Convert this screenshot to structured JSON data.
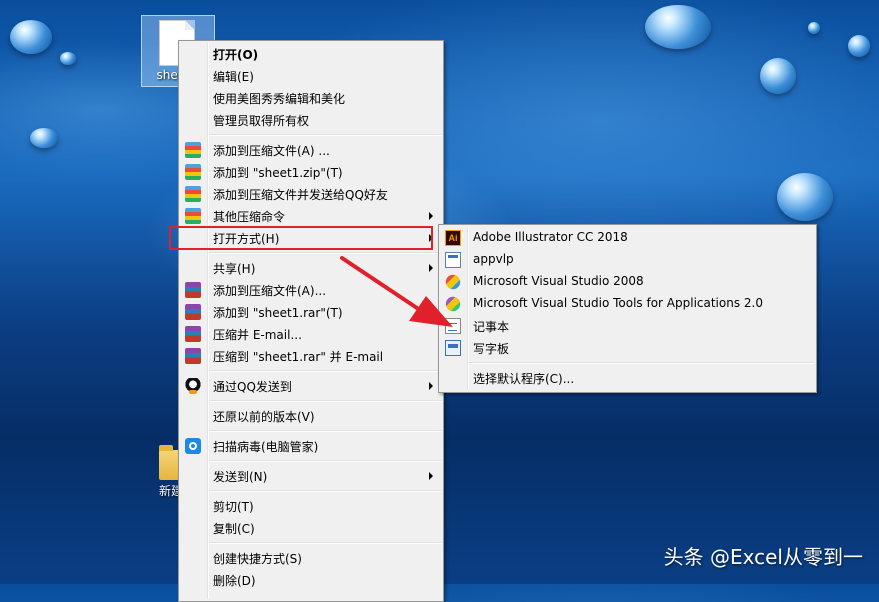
{
  "desktop": {
    "icons": [
      {
        "label": "sheet1",
        "type": "file"
      },
      {
        "label": "新建文",
        "type": "folder"
      }
    ]
  },
  "context_menu": {
    "items": [
      {
        "label": "打开(O)",
        "bold": true,
        "icon": ""
      },
      {
        "label": "编辑(E)",
        "icon": ""
      },
      {
        "label": "使用美图秀秀编辑和美化",
        "icon": ""
      },
      {
        "label": "管理员取得所有权",
        "icon": ""
      },
      {
        "label": "添加到压缩文件(A) ...",
        "icon": "zip-icon"
      },
      {
        "label": "添加到 \"sheet1.zip\"(T)",
        "icon": "zip-icon"
      },
      {
        "label": "添加到压缩文件并发送给QQ好友",
        "icon": "zip-icon"
      },
      {
        "label": "其他压缩命令",
        "icon": "zip-icon",
        "submenu": true
      },
      {
        "label": "打开方式(H)",
        "icon": "",
        "submenu": true,
        "highlighted": true
      },
      {
        "label": "共享(H)",
        "icon": "",
        "submenu": true
      },
      {
        "label": "添加到压缩文件(A)...",
        "icon": "rar-icon"
      },
      {
        "label": "添加到 \"sheet1.rar\"(T)",
        "icon": "rar-icon"
      },
      {
        "label": "压缩并 E-mail...",
        "icon": "rar-icon"
      },
      {
        "label": "压缩到 \"sheet1.rar\" 并 E-mail",
        "icon": "rar-icon"
      },
      {
        "label": "通过QQ发送到",
        "icon": "qq-icon",
        "submenu": true
      },
      {
        "label": "还原以前的版本(V)",
        "icon": ""
      },
      {
        "label": "扫描病毒(电脑管家)",
        "icon": "shield-icon"
      },
      {
        "label": "发送到(N)",
        "icon": "",
        "submenu": true
      },
      {
        "label": "剪切(T)",
        "icon": ""
      },
      {
        "label": "复制(C)",
        "icon": ""
      },
      {
        "label": "创建快捷方式(S)",
        "icon": ""
      },
      {
        "label": "删除(D)",
        "icon": ""
      }
    ]
  },
  "open_with_menu": {
    "items": [
      {
        "label": "Adobe Illustrator CC 2018",
        "icon": "illustrator-icon",
        "icon_text": "Ai"
      },
      {
        "label": "appvlp",
        "icon": "app-icon"
      },
      {
        "label": "Microsoft Visual Studio 2008",
        "icon": "visual-studio-icon"
      },
      {
        "label": "Microsoft Visual Studio Tools for Applications 2.0",
        "icon": "vsta-icon"
      },
      {
        "label": "记事本",
        "icon": "notepad-icon"
      },
      {
        "label": "写字板",
        "icon": "wordpad-icon"
      },
      {
        "label": "选择默认程序(C)...",
        "icon": ""
      }
    ]
  },
  "annotation": {
    "box_color": "#e0202a",
    "arrow_color": "#e0202a"
  },
  "watermark": "头条 @Excel从零到一"
}
